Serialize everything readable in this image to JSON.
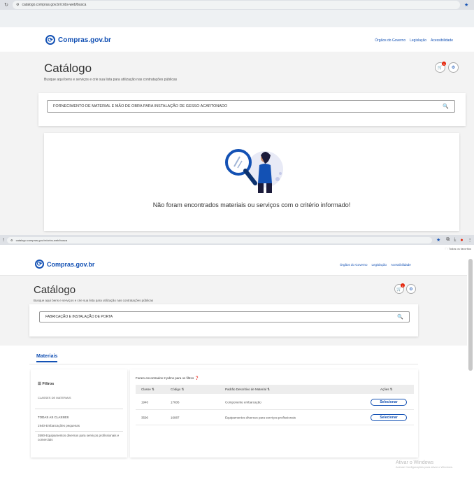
{
  "top": {
    "url": "catalogo.compras.gov.br/cnbs-web/busca",
    "logo_text": "Compras.gov.br",
    "nav": [
      "Órgãos do Governo",
      "Legislação",
      "Acessibilidade"
    ],
    "page_title": "Catálogo",
    "subtitle": "Busque aqui bens e serviços e crie sua lista para utilização nas contratações públicas",
    "cart_badge": "1",
    "search_value": "FORNECIMENTO DE MATERIAL E MÃO DE OBRA PARA INSTALAÇÃO DE GESSO ACARTONADO",
    "empty_message": "Não foram encontrados materiais ou serviços com o critério informado!"
  },
  "bottom": {
    "url": "catalogo.compras.gov.br/cnbs-web/busca",
    "bookmarks_label": "Todos os favoritos",
    "logo_text": "Compras.gov.br",
    "nav": [
      "Órgãos do Governo",
      "Legislação",
      "Acessibilidade"
    ],
    "page_title": "Catálogo",
    "subtitle": "Busque aqui bens e serviços e crie sua lista para utilização nas contratações públicas",
    "cart_badge": "1",
    "search_value": "FABRICAÇÃO E INSTALAÇÃO DE PORTA",
    "tab_label": "Materiais",
    "filters": {
      "title": "Filtros",
      "class_label": "CLASSES DE MATERIAIS",
      "all_classes": "TODAS AS CLASSES",
      "items": [
        "1940-Embarcações pequenas",
        "3590-Equipamentos diversos para serviços profissionais e comerciais"
      ]
    },
    "results_text": "Foram encontrados 2 pdms para os filtros",
    "columns": [
      "Classe",
      "Código",
      "Padrão Descritivo de Material",
      "Ações"
    ],
    "rows": [
      {
        "classe": "1940",
        "codigo": "17606",
        "descricao": "Componente embarcação",
        "acao": "Selecionar"
      },
      {
        "classe": "3590",
        "codigo": "16887",
        "descricao": "Equipamentos diversos para serviços profissionais",
        "acao": "Selecionar"
      }
    ],
    "watermark_title": "Ativar o Windows",
    "watermark_sub": "Acesse Configurações para ativar o Windows."
  },
  "colors": {
    "brand": "#1351b4",
    "badge": "#e52207",
    "band": "#f3f3f3"
  }
}
